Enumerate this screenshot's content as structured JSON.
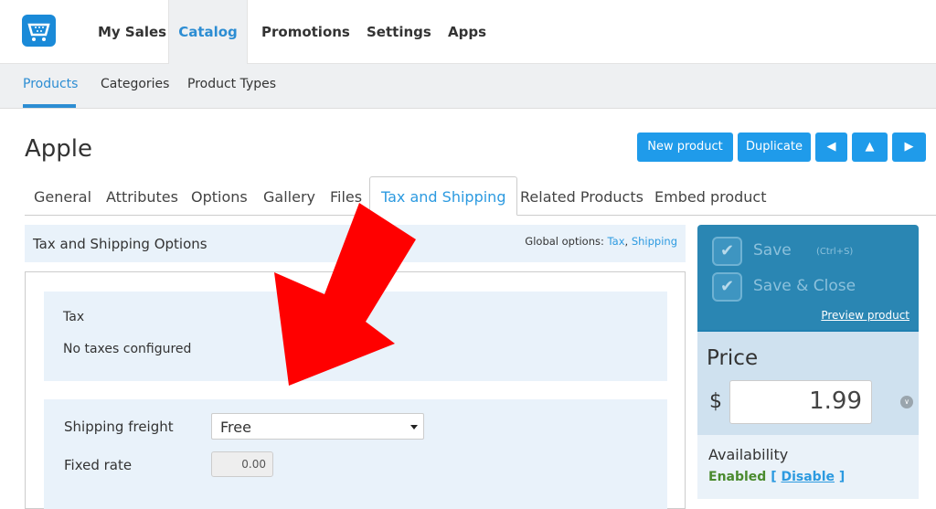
{
  "topnav": {
    "items": [
      {
        "label": "My Sales"
      },
      {
        "label": "Catalog"
      },
      {
        "label": "Promotions"
      },
      {
        "label": "Settings"
      },
      {
        "label": "Apps"
      }
    ]
  },
  "subnav": {
    "items": [
      {
        "label": "Products"
      },
      {
        "label": "Categories"
      },
      {
        "label": "Product Types"
      }
    ]
  },
  "page": {
    "title": "Apple"
  },
  "toolbar": {
    "new_product": "New product",
    "duplicate": "Duplicate"
  },
  "tabs": [
    "General",
    "Attributes",
    "Options",
    "Gallery",
    "Files",
    "Tax and Shipping",
    "Related Products",
    "Embed product"
  ],
  "options": {
    "title": "Tax and Shipping Options",
    "global_label": "Global options:",
    "tax_link": "Tax",
    "shipping_link": "Shipping"
  },
  "tax": {
    "title": "Tax",
    "message": "No taxes configured"
  },
  "shipping": {
    "freight_label": "Shipping freight",
    "freight_value": "Free",
    "rate_label": "Fixed rate",
    "rate_value": "0.00"
  },
  "sidebar": {
    "save": "Save",
    "save_shortcut": "(Ctrl+S)",
    "save_close": "Save & Close",
    "preview": "Preview product",
    "price_title": "Price",
    "currency": "$",
    "price_value": "1.99",
    "availability_title": "Availability",
    "status": "Enabled",
    "disable": "Disable"
  },
  "colors": {
    "accent": "#1f9bea",
    "annotation": "#ff0000"
  }
}
